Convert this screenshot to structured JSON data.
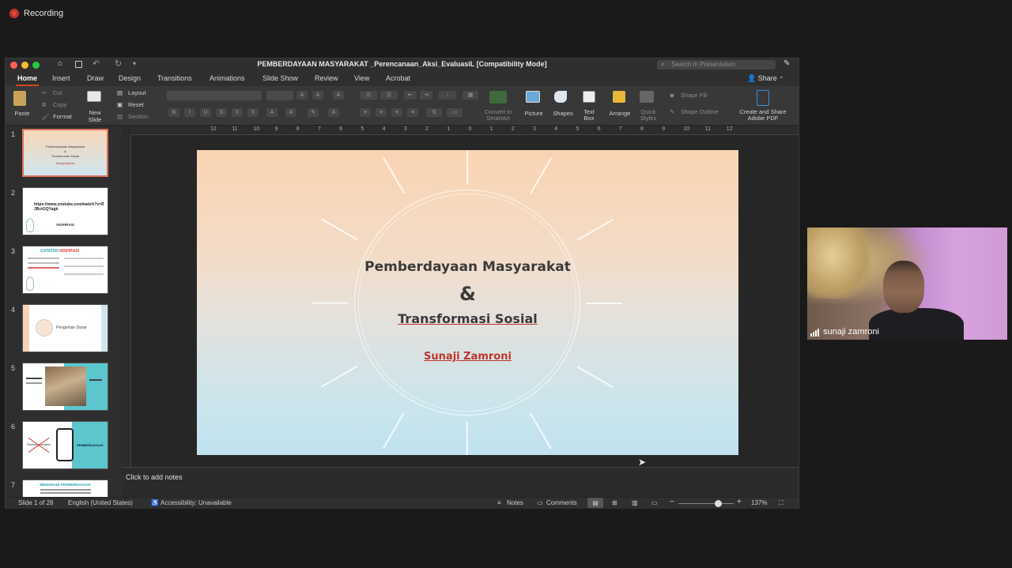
{
  "recording": {
    "label": "Recording"
  },
  "window": {
    "title": "PEMBERDAYAAN MASYARAKAT _Perencanaan_Aksi_EvaluasiL [Compatibility Mode]",
    "search_placeholder": "Search in Presentation"
  },
  "tabs": [
    "Home",
    "Insert",
    "Draw",
    "Design",
    "Transitions",
    "Animations",
    "Slide Show",
    "Review",
    "View",
    "Acrobat"
  ],
  "share_label": "Share",
  "ribbon": {
    "paste": "Paste",
    "cut": "Cut",
    "copy": "Copy",
    "format": "Format",
    "new_slide": "New Slide",
    "layout": "Layout",
    "reset": "Reset",
    "section": "Section",
    "convert": "Convert to SmartArt",
    "picture": "Picture",
    "shapes": "Shapes",
    "text_box": "Text Box",
    "arrange": "Arrange",
    "quick_styles": "Quick Styles",
    "shape_fill": "Shape Fill",
    "shape_outline": "Shape Outline",
    "adobe": "Create and Share Adobe PDF"
  },
  "ruler_ticks": [
    "12",
    "11",
    "10",
    "9",
    "8",
    "7",
    "6",
    "5",
    "4",
    "3",
    "2",
    "1",
    "0",
    "1",
    "2",
    "3",
    "4",
    "5",
    "6",
    "7",
    "8",
    "9",
    "10",
    "11",
    "12"
  ],
  "thumbnails": [
    {
      "num": "1",
      "title": "Pemberdayaan Masyarakat",
      "sub": "&",
      "sub2": "Transformasi Sosial",
      "author": "Sunaji Zamroni"
    },
    {
      "num": "2",
      "link": "https://www.youtube.com/watch?v=RJBctGQYagk",
      "caption": "INSPIRASI"
    },
    {
      "num": "3",
      "title_a": "CATATAN",
      "title_b": "INSPIRASI"
    },
    {
      "num": "4",
      "title": "Pengertian Dasar"
    },
    {
      "num": "5"
    },
    {
      "num": "6",
      "left": "Pembangunanisme",
      "right": "PEMBERDAYAAN"
    },
    {
      "num": "7",
      "title": "MEMAHAMI PEMBERDAYAAN"
    }
  ],
  "slide": {
    "title": "Pemberdayaan Masyarakat",
    "ampersand": "&",
    "subtitle": "Transformasi Sosial",
    "author": "Sunaji Zamroni"
  },
  "notes_placeholder": "Click to add notes",
  "status": {
    "slide_info": "Slide 1 of 28",
    "language": "English (United States)",
    "accessibility": "Accessibility: Unavailable",
    "notes": "Notes",
    "comments": "Comments",
    "zoom": "137%"
  },
  "video": {
    "participant": "sunaji zamroni"
  },
  "colors": {
    "accent": "#d24726",
    "author_red": "#c0332b"
  }
}
